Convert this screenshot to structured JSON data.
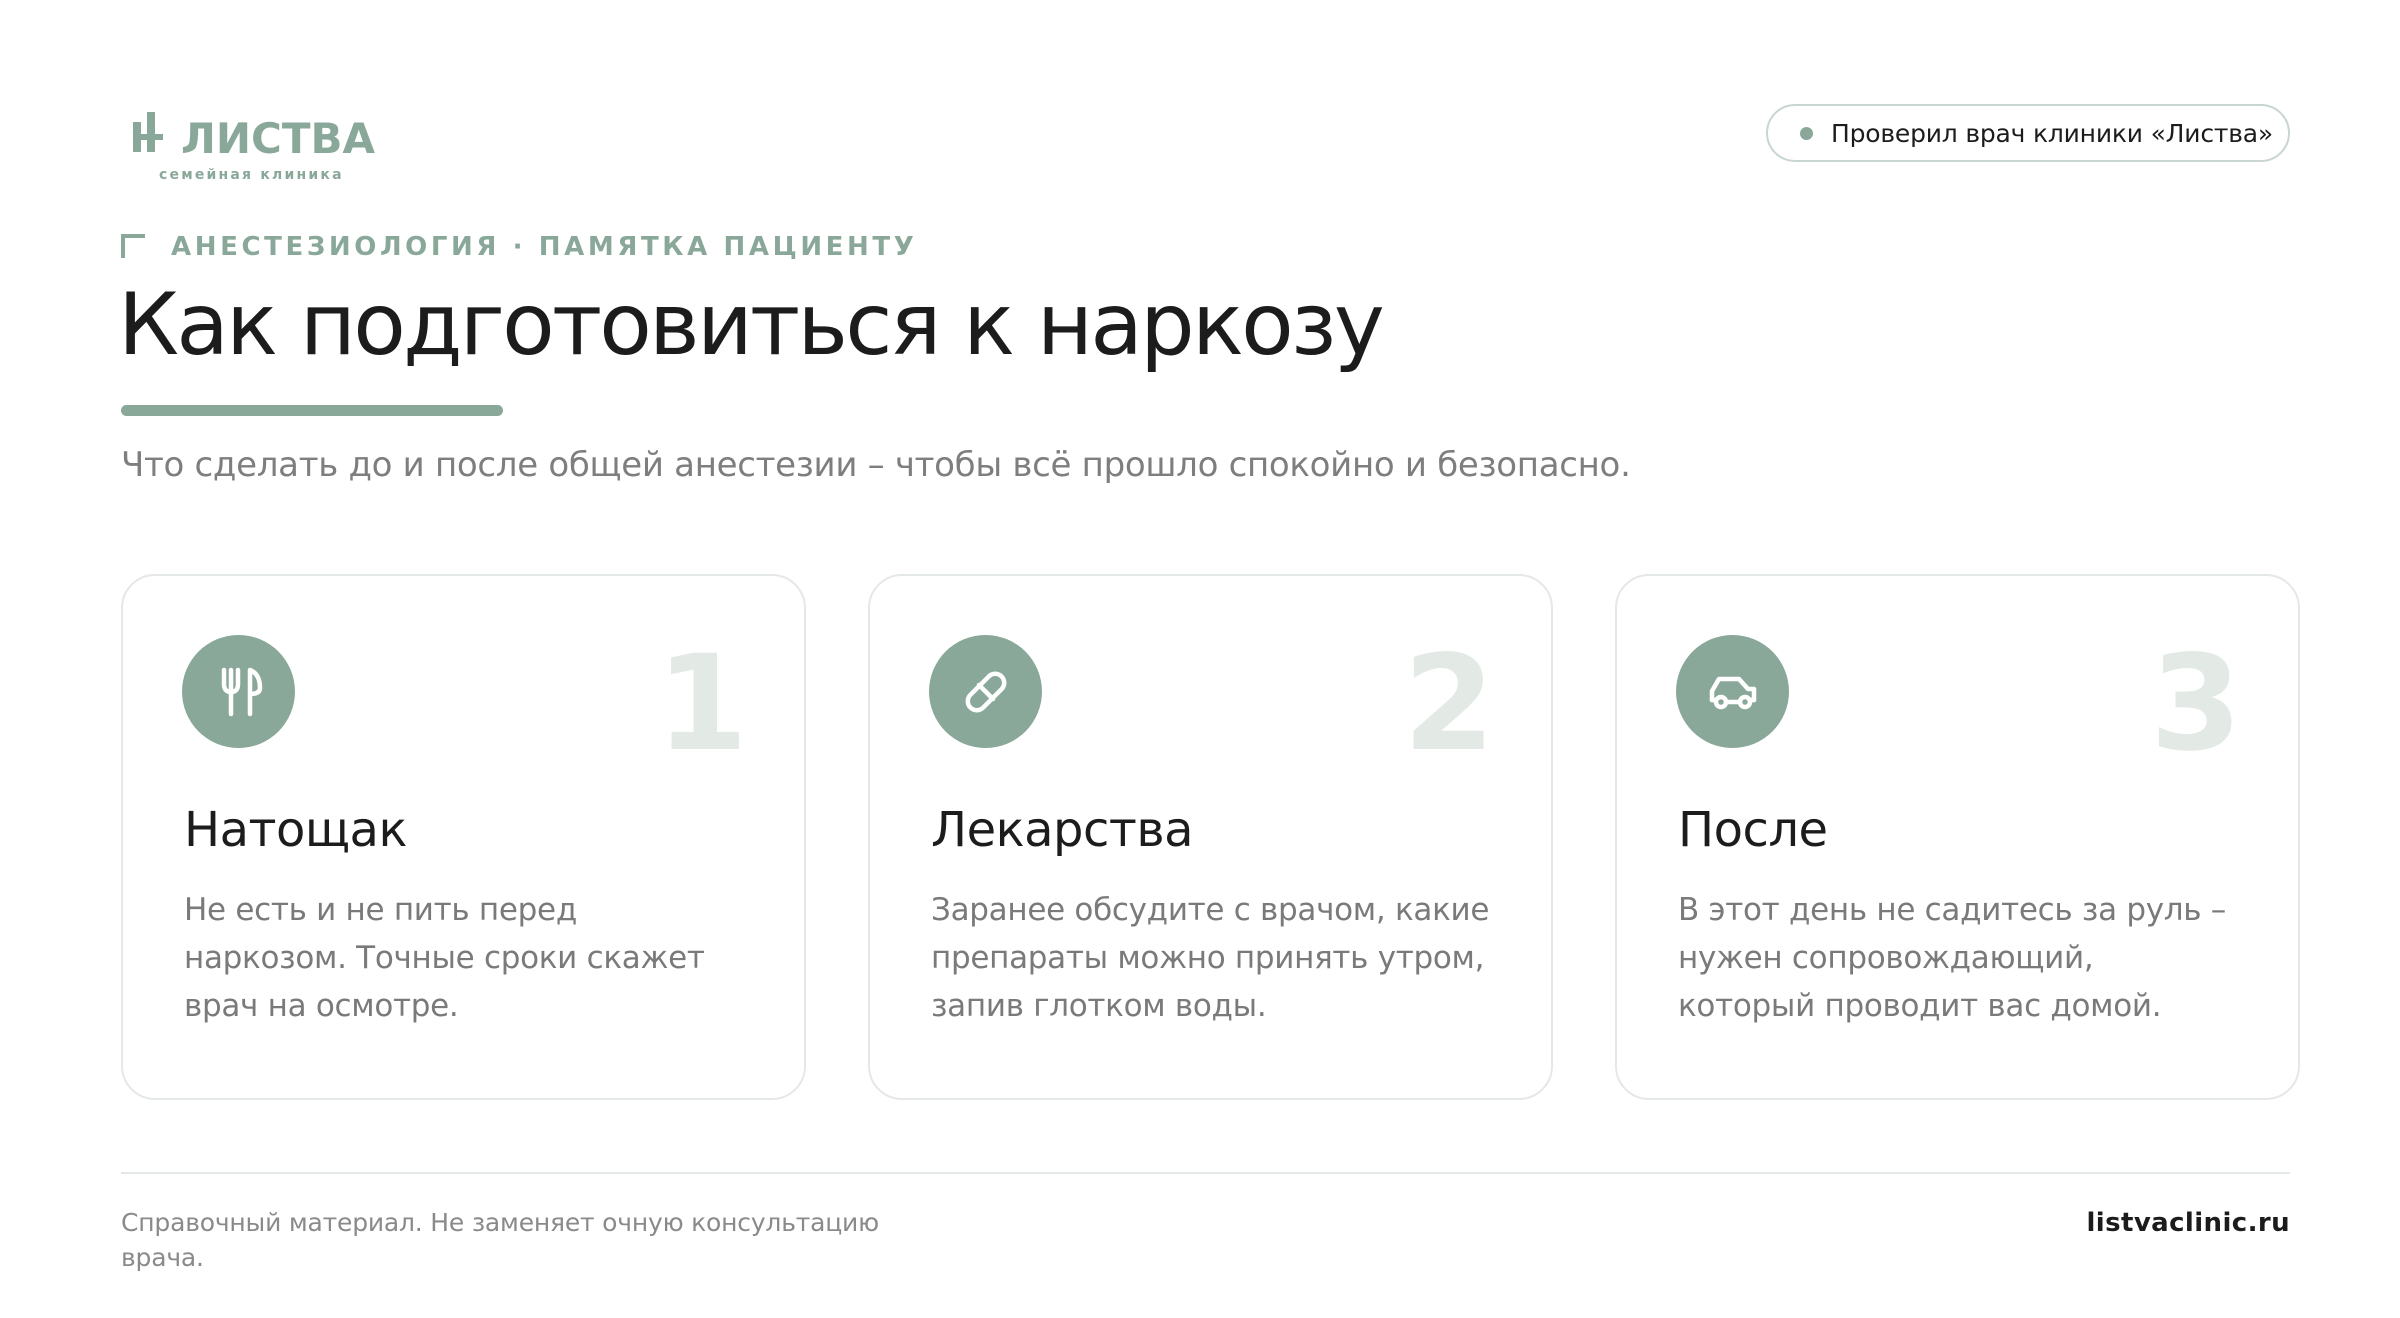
{
  "brand": {
    "name": "ЛИСТВА",
    "tagline": "семейная клиника",
    "accent_color": "#8aa899",
    "logo_icon": "leaf-cross-icon"
  },
  "badge": {
    "text": "Проверил врач клиники «Листва»"
  },
  "header": {
    "kicker": "АНЕСТЕЗИОЛОГИЯ · ПАМЯТКА ПАЦИЕНТУ",
    "title": "Как подготовиться к наркозу",
    "subtitle": "Что сделать до и после общей анестезии – чтобы всё прошло спокойно и безопасно."
  },
  "cards": [
    {
      "number": "1",
      "icon": "fork-knife-icon",
      "title": "Натощак",
      "text": "Не есть и не пить перед наркозом. Точные сроки скажет врач на осмотре."
    },
    {
      "number": "2",
      "icon": "pill-icon",
      "title": "Лекарства",
      "text": "Заранее обсудите с врачом, какие препараты можно принять утром, запив глотком воды."
    },
    {
      "number": "3",
      "icon": "car-icon",
      "title": "После",
      "text": "В этот день не садитесь за руль – нужен сопровождающий, который проводит вас домой."
    }
  ],
  "footer": {
    "note": "Справочный материал. Не заменяет очную консультацию врача.",
    "site": "listvaclinic.ru"
  }
}
